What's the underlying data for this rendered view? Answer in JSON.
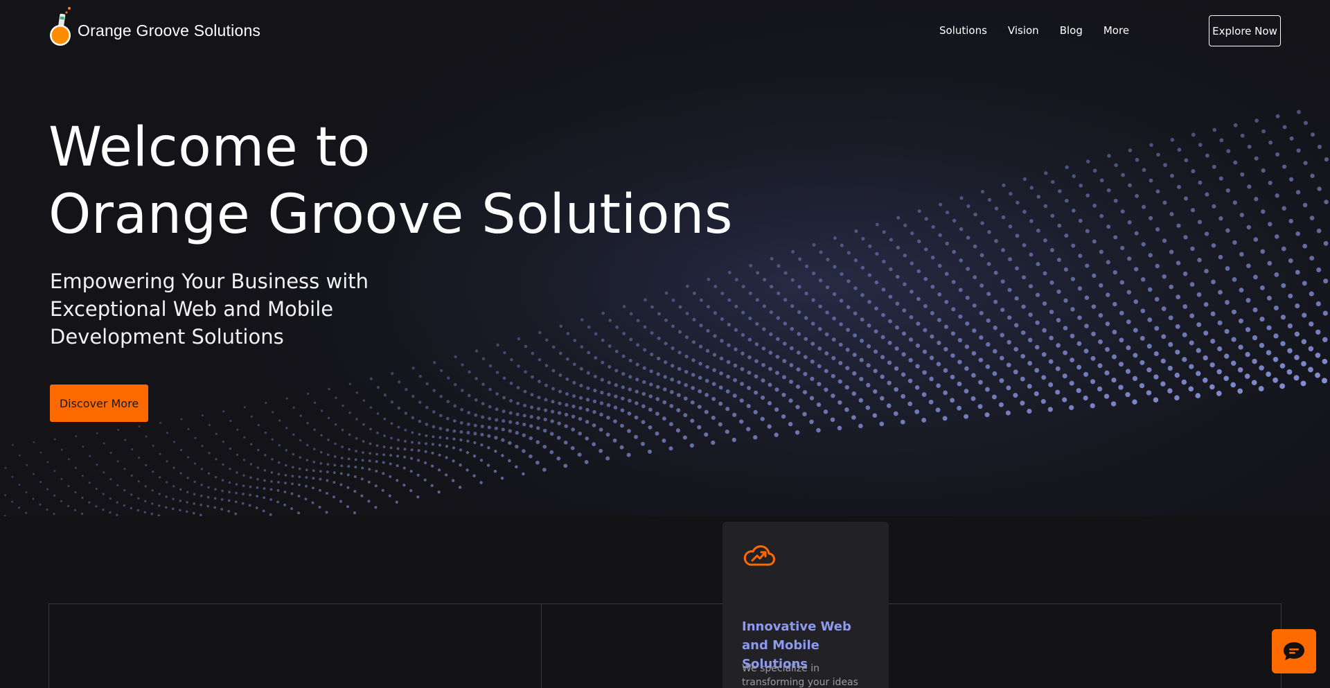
{
  "header": {
    "brand": "Orange Groove Solutions",
    "nav": [
      "Solutions",
      "Vision",
      "Blog",
      "More"
    ],
    "cta": "Explore Now"
  },
  "hero": {
    "title_line1": "Welcome to",
    "title_line2": "Orange Groove Solutions",
    "subtitle": "Empowering Your Business with Exceptional Web and Mobile Development Solutions",
    "button": "Discover More"
  },
  "card": {
    "icon": "cloud-growth-icon",
    "title": "Innovative Web and Mobile Solutions",
    "text": "We specialize in transforming your ideas"
  },
  "chat": {
    "icon": "chat-icon"
  },
  "colors": {
    "accent": "#ff6a00",
    "card_title": "#8d9aef",
    "background": "#131316",
    "dots": "#8f9be8"
  }
}
